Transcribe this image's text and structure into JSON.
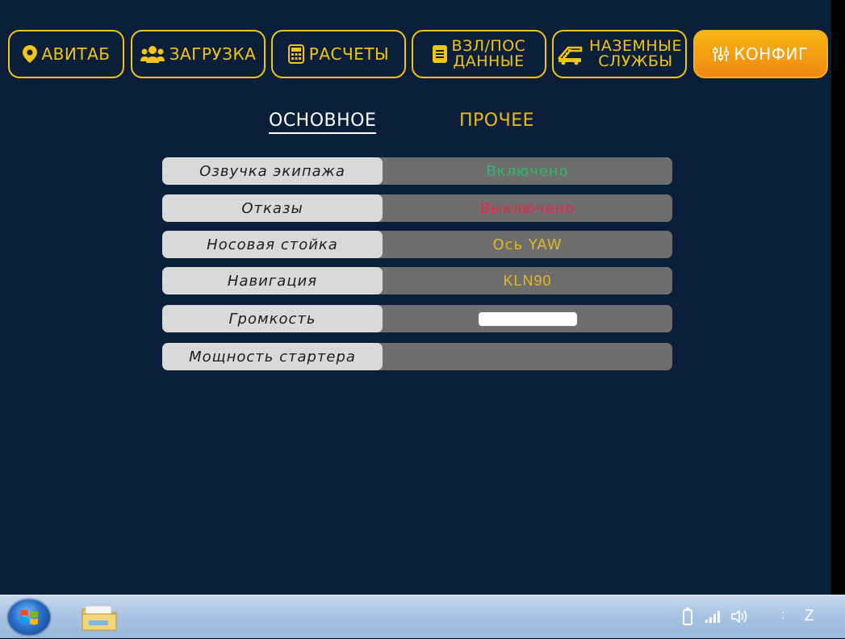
{
  "nav": {
    "tabs": [
      {
        "label": "АВИТАБ",
        "icon": "map-pin-icon"
      },
      {
        "label": "ЗАГРУЗКА",
        "icon": "users-icon"
      },
      {
        "label": "РАСЧЕТЫ",
        "icon": "calculator-icon"
      },
      {
        "label_line1": "ВЗЛ/ПОС",
        "label_line2": "ДАННЫЕ",
        "icon": "document-icon"
      },
      {
        "label_line1": "НАЗЕМНЫЕ",
        "label_line2": "СЛУЖБЫ",
        "icon": "stairs-truck-icon"
      },
      {
        "label": "КОНФИГ",
        "icon": "sliders-icon",
        "active": true
      }
    ]
  },
  "subtabs": {
    "main": "ОСНОВНОЕ",
    "other": "ПРОЧЕЕ"
  },
  "settings": [
    {
      "label": "Озвучка экипажа",
      "value": "Включено",
      "value_color": "#2fb86a"
    },
    {
      "label": "Отказы",
      "value": "Выключено",
      "value_color": "#e8264a"
    },
    {
      "label": "Носовая стойка",
      "value": "Ось YAW",
      "value_color": "#e3b821"
    },
    {
      "label": "Навигация",
      "value": "KLN90",
      "value_color": "#e3b821"
    },
    {
      "label": "Громкость",
      "value_fraction": 1.0
    },
    {
      "label": "Мощность стартера",
      "value": ""
    }
  ],
  "taskbar": {
    "start_icon": "windows-start-icon",
    "pinned": [
      "file-explorer-icon"
    ],
    "tray": [
      "battery-icon",
      "signal-icon",
      "volume-icon"
    ],
    "separator": ":",
    "clock_fragment": "Z"
  },
  "colors": {
    "background": "#0b1e3a",
    "accent": "#f2c514",
    "active_tab": "#f29a12"
  }
}
